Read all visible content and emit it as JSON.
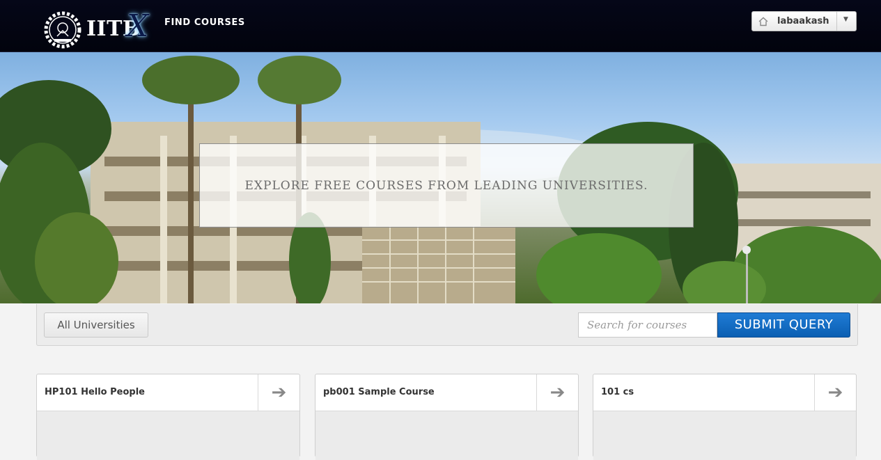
{
  "header": {
    "logo_text": "IITB",
    "logo_x": "X",
    "nav_find_courses": "FIND COURSES",
    "user": {
      "icon": "home-icon",
      "name": "labaakash",
      "caret": "▼"
    }
  },
  "hero": {
    "title": "EXPLORE FREE COURSES FROM LEADING UNIVERSITIES."
  },
  "filter": {
    "universities_label": "All Universities",
    "search_placeholder": "Search for courses",
    "submit_label": "SUBMIT QUERY"
  },
  "courses": [
    {
      "title": "HP101 Hello People"
    },
    {
      "title": "pb001 Sample Course"
    },
    {
      "title": "101 cs"
    }
  ],
  "colors": {
    "header_bg": "#02030d",
    "submit_bg": "#0b5fb3"
  }
}
